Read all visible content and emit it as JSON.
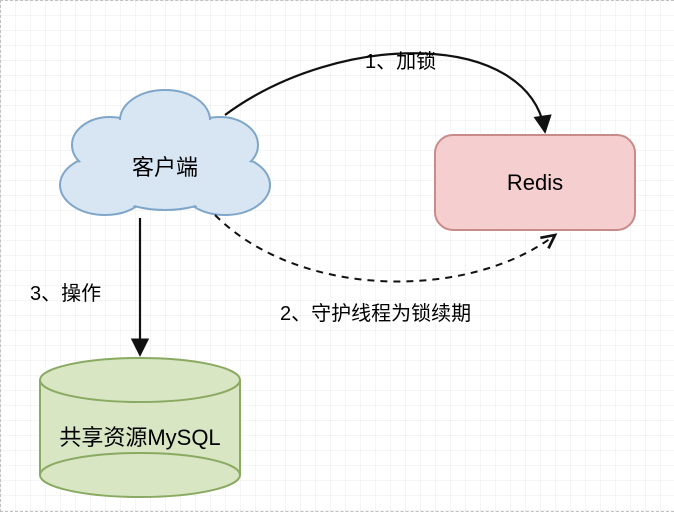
{
  "nodes": {
    "client": {
      "label": "客户端"
    },
    "redis": {
      "label": "Redis"
    },
    "mysql": {
      "label": "共享资源MySQL"
    }
  },
  "edges": {
    "lock": {
      "label": "1、加锁"
    },
    "renew": {
      "label": "2、守护线程为锁续期"
    },
    "operate": {
      "label": "3、操作"
    }
  },
  "colors": {
    "clientFill": "#d8e6f4",
    "clientStroke": "#7fa6c9",
    "redisFill": "#f5cfcf",
    "redisStroke": "#c98a8a",
    "mysqlFill": "#d8e6c3",
    "mysqlStroke": "#8aaa62",
    "line": "#111111"
  }
}
